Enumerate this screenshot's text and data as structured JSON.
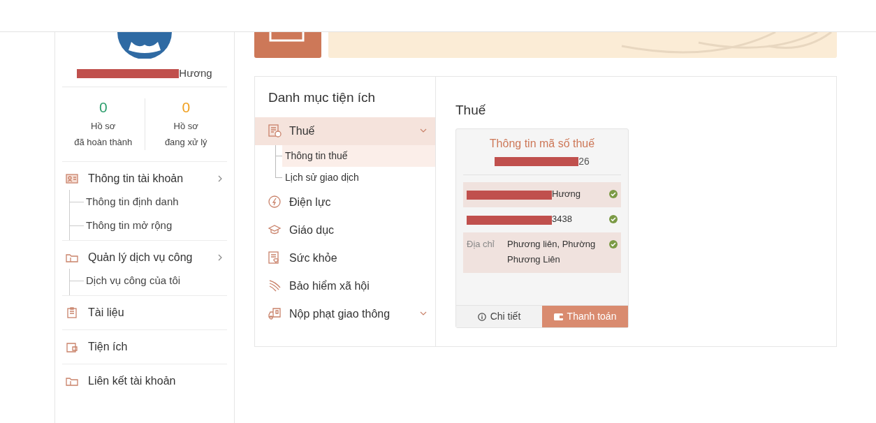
{
  "profile": {
    "name": "Hương",
    "redacted": true
  },
  "stats": [
    {
      "count": "0",
      "label": "Hồ sơ\nđã hoàn thành",
      "color": "#2e9e6e"
    },
    {
      "count": "0",
      "label": "Hồ sơ\nđang xử lý",
      "color": "#f0a020"
    }
  ],
  "account_menu": [
    {
      "label": "Thông tin tài khoản",
      "chevron": true,
      "children": [
        {
          "label": "Thông tin định danh"
        },
        {
          "label": "Thông tin mở rộng"
        }
      ]
    },
    {
      "label": "Quản lý dịch vụ công",
      "chevron": true,
      "children": [
        {
          "label": "Dịch vụ công của tôi"
        }
      ]
    },
    {
      "label": "Tài liệu",
      "chevron": false
    },
    {
      "label": "Tiện ích",
      "chevron": false
    },
    {
      "label": "Liên kết tài khoản",
      "chevron": false
    }
  ],
  "utilities": {
    "title": "Danh mục tiện ích",
    "items": [
      {
        "label": "Thuế",
        "selected": true,
        "chevron": true,
        "children": [
          {
            "label": "Thông tin thuế",
            "selected": true
          },
          {
            "label": "Lịch sử giao dịch",
            "selected": false
          }
        ]
      },
      {
        "label": "Điện lực",
        "selected": false,
        "chevron": false
      },
      {
        "label": "Giáo dục",
        "selected": false,
        "chevron": false
      },
      {
        "label": "Sức khỏe",
        "selected": false,
        "chevron": false
      },
      {
        "label": "Bảo hiểm xã hội",
        "selected": false,
        "chevron": false
      },
      {
        "label": "Nộp phạt giao thông",
        "selected": false,
        "chevron": true
      }
    ]
  },
  "detail": {
    "heading": "Thuế",
    "card": {
      "title": "Thông tin mã số thuế",
      "tax_code": {
        "value": "26",
        "redacted": true
      },
      "rows": [
        {
          "value": "Hương",
          "redacted": true,
          "verified": true
        },
        {
          "value": "3438",
          "redacted": true,
          "verified": true
        },
        {
          "label": "Địa chỉ",
          "value": "Phương liên, Phường Phương Liên",
          "verified": true
        }
      ],
      "buttons": [
        {
          "label": "Chi tiết",
          "kind": "info"
        },
        {
          "label": "Thanh toán",
          "kind": "pay"
        }
      ]
    }
  }
}
